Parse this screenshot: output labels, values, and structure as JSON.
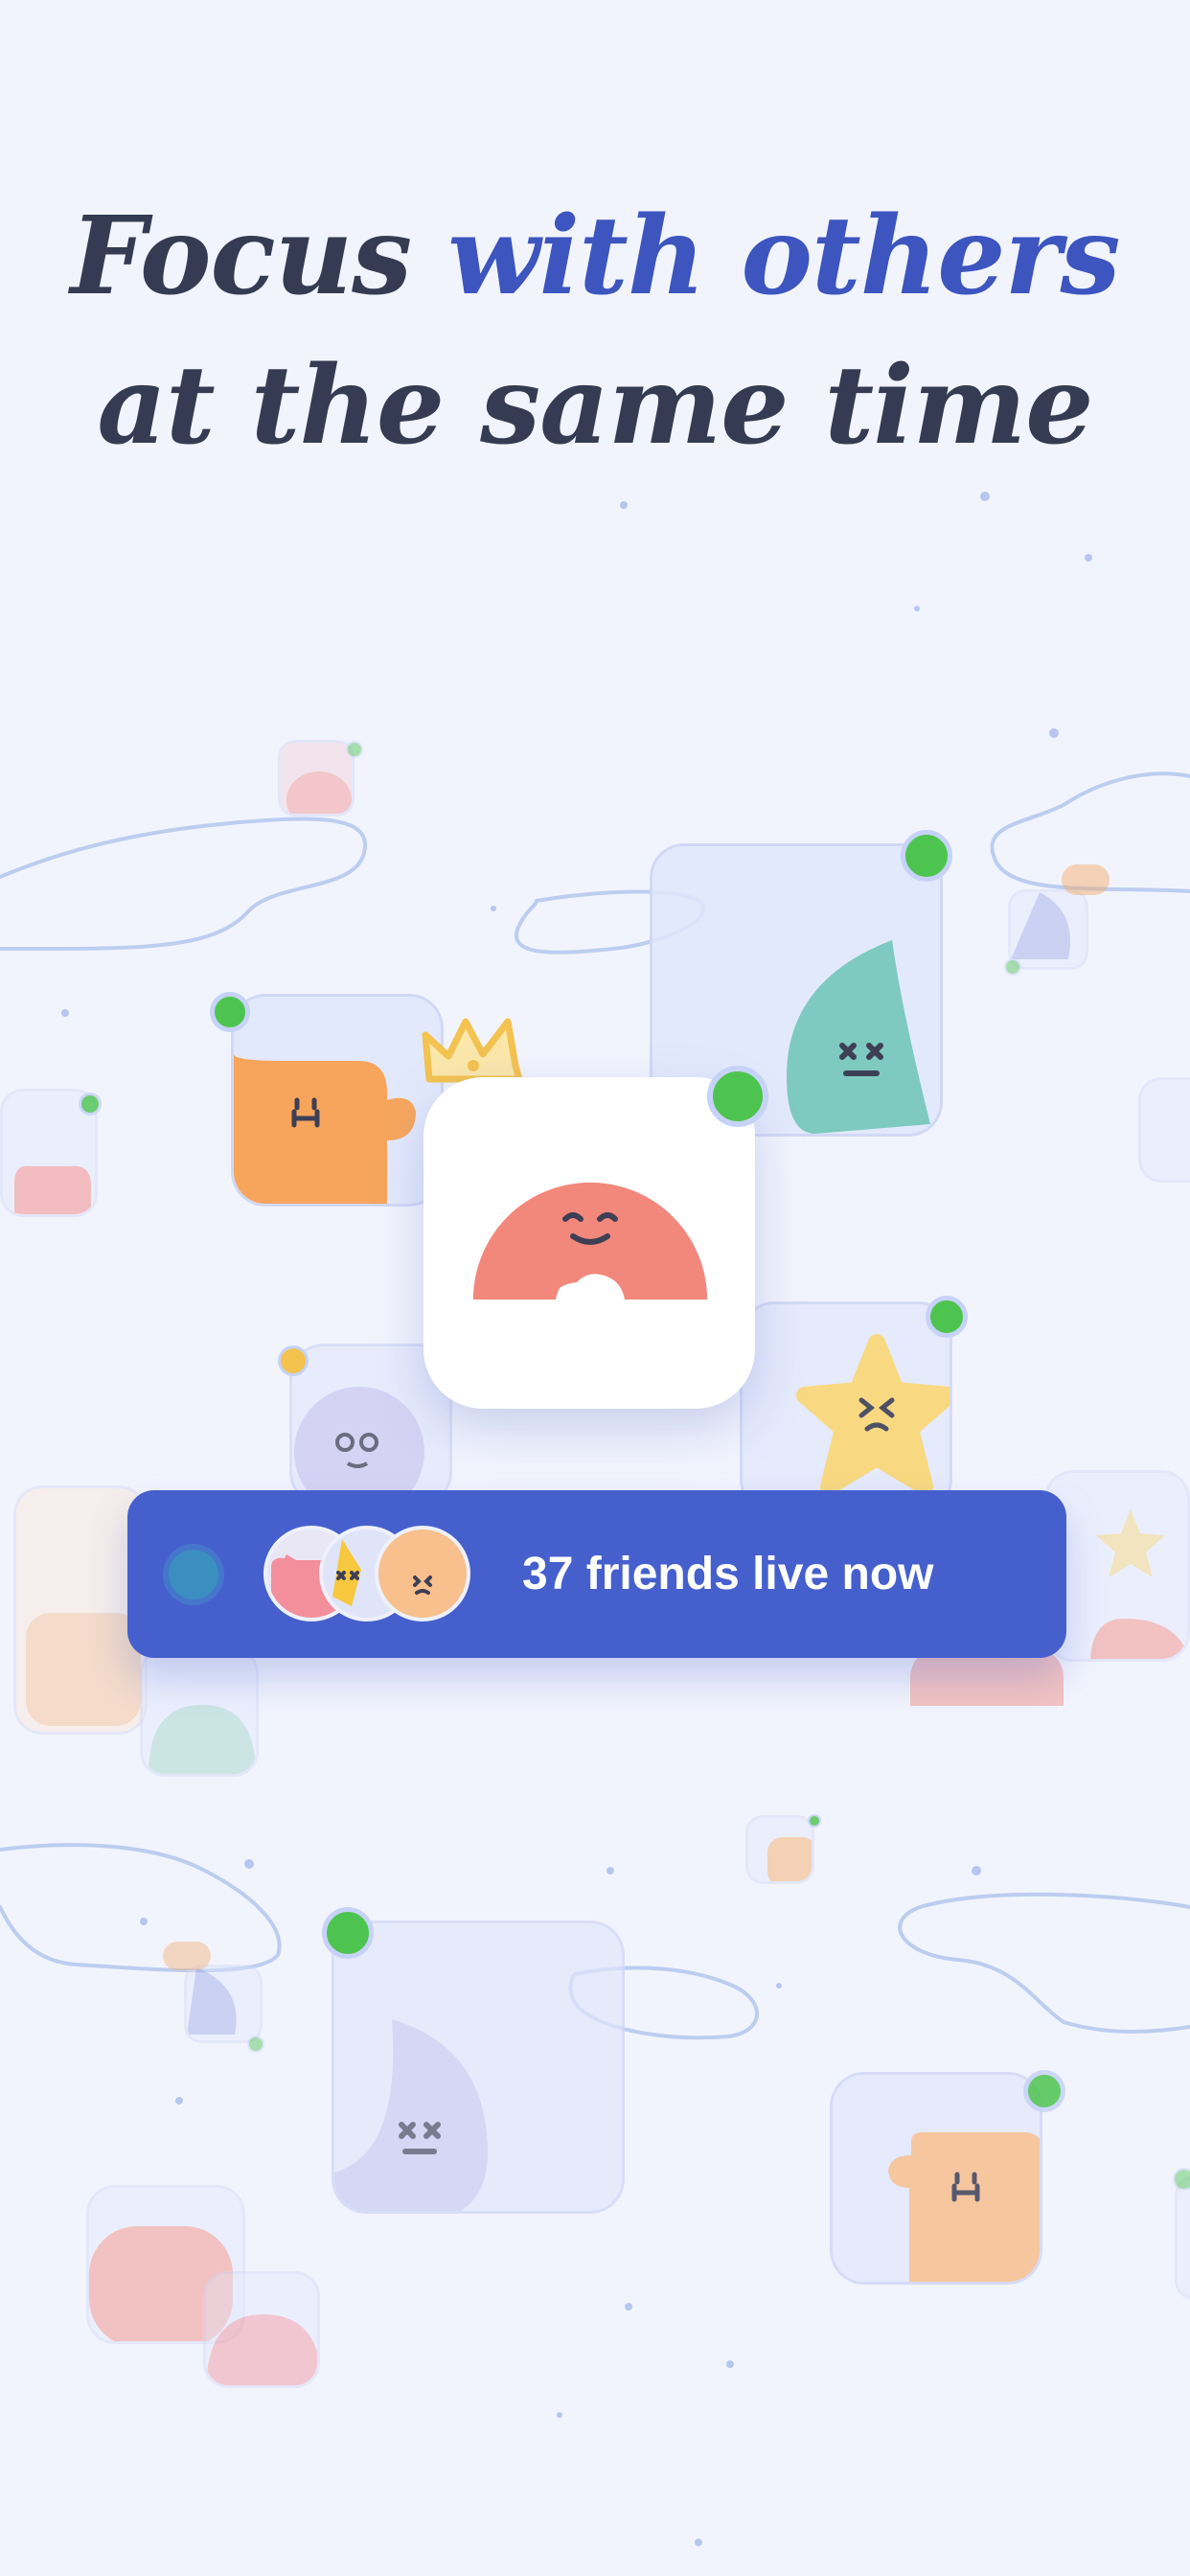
{
  "headline": {
    "line1_plain": "Focus ",
    "line1_accent": "with others",
    "line2": "at the same time"
  },
  "live_banner": {
    "text": "37 friends live now",
    "avatars": [
      "pink-blob-avatar",
      "yellow-star-avatar",
      "peach-blob-avatar"
    ]
  },
  "colors": {
    "background": "#f2f4fd",
    "headline_text": "#353b52",
    "headline_accent": "#3c55bf",
    "banner": "#4560cd",
    "online_dot": "#4dc44f",
    "hero_character": "#f2877b",
    "crown": "#f3c24f"
  },
  "icons": {
    "crown": "crown-icon",
    "online": "online-status-icon"
  }
}
